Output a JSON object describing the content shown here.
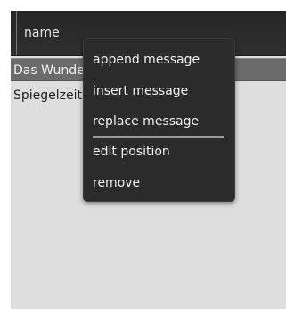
{
  "table": {
    "column_header": "name",
    "rows": [
      {
        "label": "Das Wunderhorn",
        "selected": true
      },
      {
        "label": "Spiegelzeit",
        "selected": false
      }
    ]
  },
  "context_menu": {
    "items": [
      {
        "label": "append message"
      },
      {
        "label": "insert message"
      },
      {
        "label": "replace message"
      },
      {
        "label": "edit position"
      },
      {
        "label": "remove"
      }
    ]
  },
  "colors": {
    "header_bg": "#2a2a2a",
    "panel_bg": "#dedede",
    "selected_row_bg": "#6b6b6b",
    "menu_bg": "#2b2b2b",
    "menu_text": "#f0f0f0"
  }
}
